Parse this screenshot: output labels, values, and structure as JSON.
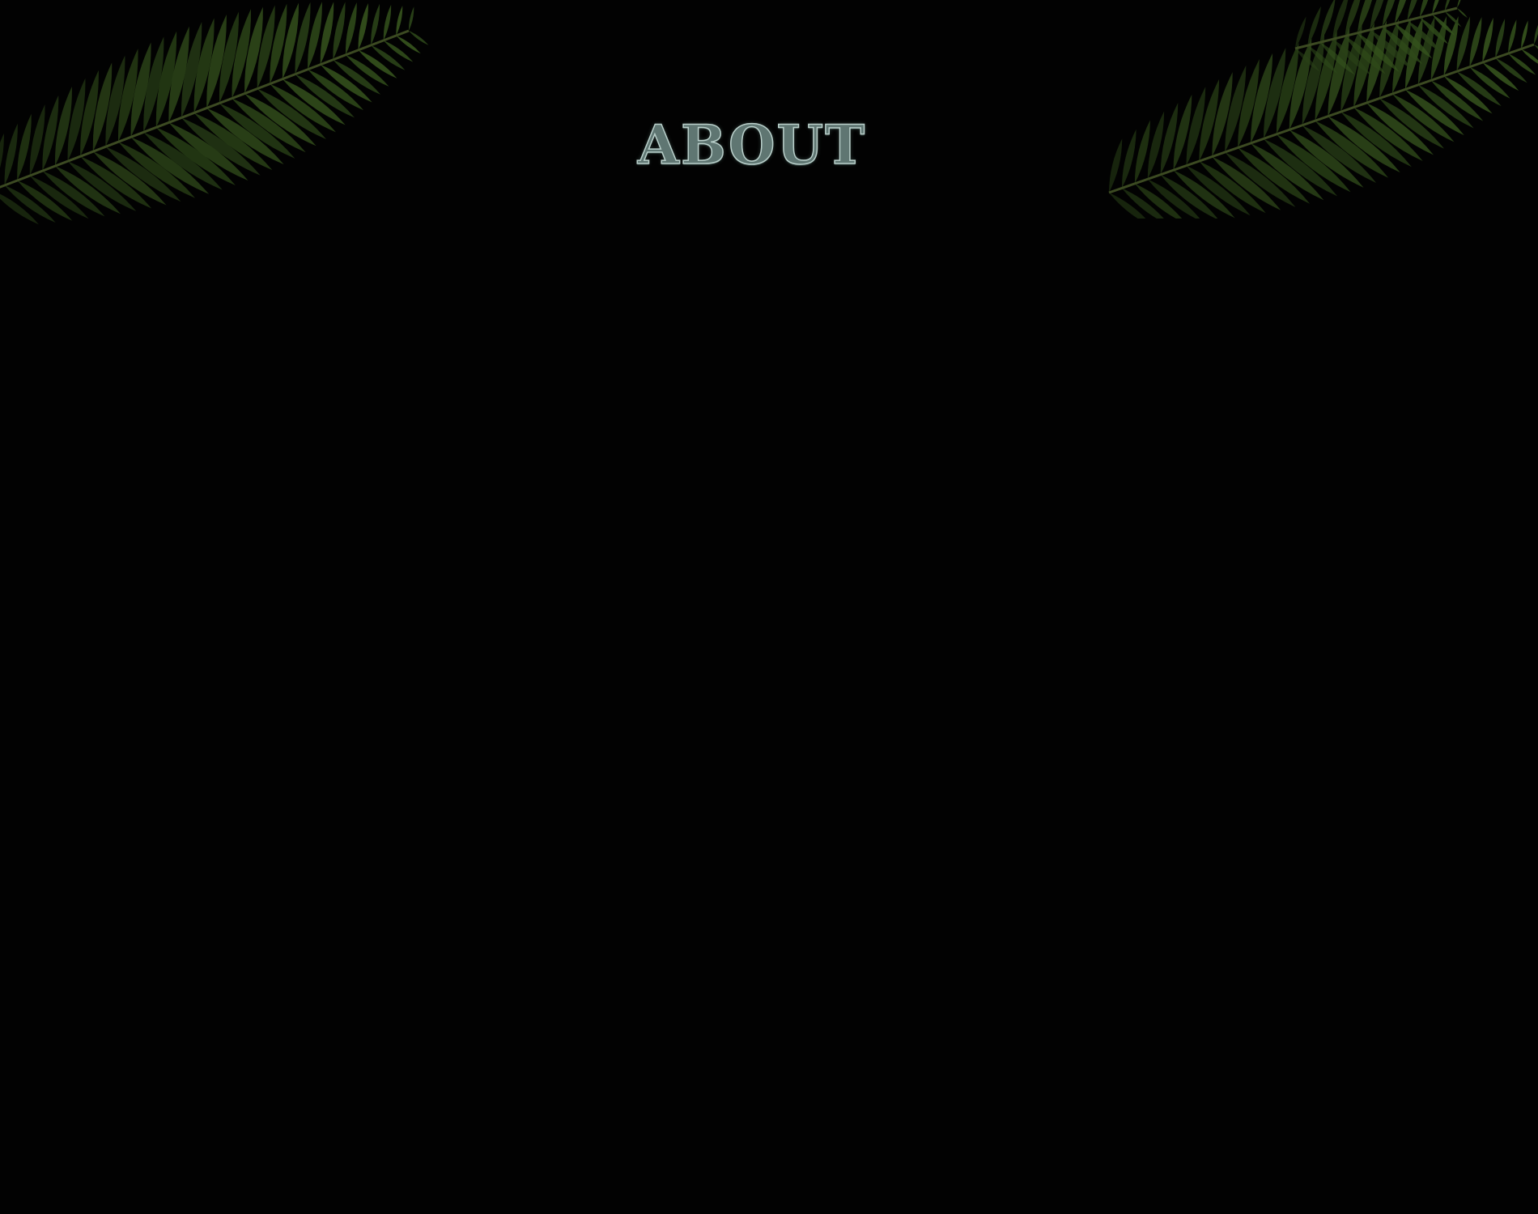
{
  "page": {
    "title": "ABOUT",
    "background_color": "#020202",
    "title_color": "#5f7672",
    "fern_color": "#2f4a1a",
    "decorations": [
      "fern-left",
      "fern-right"
    ]
  }
}
